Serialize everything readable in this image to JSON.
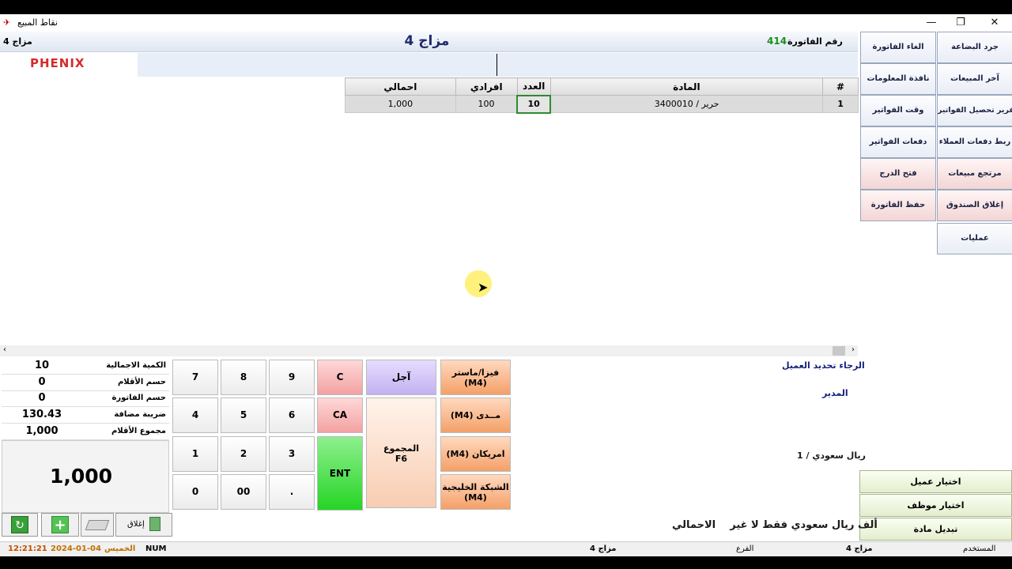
{
  "window": {
    "title": "نقاط المبيع",
    "minimize": "—",
    "restore": "❐",
    "close": "✕"
  },
  "header": {
    "left_label": "مزاج 4",
    "center_title": "مزاج 4",
    "invoice_label": "رقم الفاتورة",
    "invoice_number": "414"
  },
  "logo": "PHENIX",
  "grid": {
    "columns": [
      "#",
      "المادة",
      "العدد",
      "افرادي",
      "احمالي"
    ],
    "rows": [
      {
        "num": "1",
        "item": "3400010 / حرير",
        "qty": "10",
        "unit": "100",
        "total": "1,000"
      }
    ]
  },
  "side_buttons": {
    "right": [
      "جرد البضاعة",
      "آخر المبيعات",
      "تقرير تحصيل الفواتير",
      "ربط دفعات العملاء",
      "مرتجع مبيعات",
      "إغلاق الصندوق",
      "عمليات"
    ],
    "left": [
      "الغاء الفاتورة",
      "نافذة المعلومات",
      "وقت الفواتير",
      "دفعات الفواتير",
      "فتح الدرج",
      "حفظ الفاتورة"
    ]
  },
  "summary": {
    "total_qty_label": "الكمية الاجمالية",
    "total_qty": "10",
    "item_discount_label": "حسم الأقلام",
    "item_discount": "0",
    "invoice_discount_label": "حسم الفاتورة",
    "invoice_discount": "0",
    "vat_label": "ضريبة مضافة",
    "vat": "130.43",
    "items_total_label": "مجموع الأقلام",
    "items_total": "1,000",
    "grand_total": "1,000"
  },
  "keypad": {
    "digits": [
      "7",
      "8",
      "9",
      "4",
      "5",
      "6",
      "1",
      "2",
      "3",
      "0",
      "00",
      "."
    ],
    "clear": "C",
    "clear_all": "CA",
    "enter": "ENT",
    "defer": "آجل",
    "total": "المجموع",
    "total_key": "F6"
  },
  "payments": [
    {
      "label": "فيزا/ماستر",
      "code": "(M4)"
    },
    {
      "label": "مــدى",
      "code": "(M4)"
    },
    {
      "label": "امريكان",
      "code": "(M4)"
    },
    {
      "label": "الشبكة الخليجية",
      "code": "(M4)"
    }
  ],
  "info": {
    "select_customer_prompt": "الرجاء تحديد العميل",
    "manager": "المدير",
    "currency": "ريال سعودي / 1"
  },
  "actions": [
    "اختيار عميل",
    "اختيار موظف",
    "تبديل مادة"
  ],
  "toolbar": {
    "close_label": "إغلاق"
  },
  "amount_words": {
    "label": "الاحمالي",
    "text": "ألف ريال سعودي  فقط  لا غير"
  },
  "status_bar": {
    "user_label": "المستخدم",
    "user": "مزاج 4",
    "branch_label": "الفرع",
    "branch": "مزاج 4",
    "num": "NUM",
    "day": "الخميس",
    "date": "2024-01-04",
    "time": "12:21:21"
  }
}
